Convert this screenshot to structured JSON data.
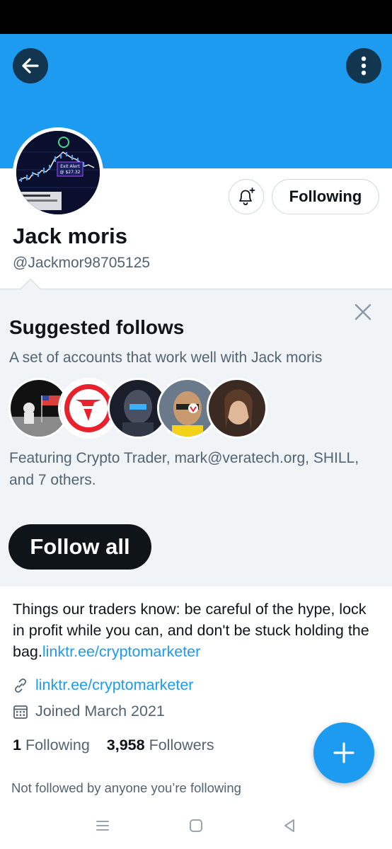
{
  "colors": {
    "accent": "#1d9bf0",
    "text": "#0f1419",
    "secondary": "#536471",
    "banner": "#1d9bf0",
    "panel_bg": "#f1f4f7"
  },
  "header": {
    "back_icon": "arrow-left-icon",
    "more_icon": "more-vertical-icon"
  },
  "profile": {
    "display_name": "Jack moris",
    "handle": "@Jackmor98705125",
    "following_button": "Following",
    "notify_icon": "bell-plus-icon",
    "avatar_text_top": "Exit Alert",
    "avatar_text_price": "@ $27.32"
  },
  "suggested": {
    "title": "Suggested follows",
    "subtitle": "A set of accounts that work well with Jack moris",
    "featuring": "Featuring Crypto Trader, mark@veratech.org, SHILL, and 7 others.",
    "follow_all": "Follow all",
    "close_icon": "close-icon"
  },
  "bio": {
    "text": "Things our traders know: be careful of the hype, lock in profit while you can, and don't be stuck holding the bag.",
    "link": "linktr.ee/cryptomarketer"
  },
  "meta": {
    "website": "linktr.ee/cryptomarketer",
    "joined": "Joined March 2021"
  },
  "stats": {
    "following_count": "1",
    "following_label": "Following",
    "followers_count": "3,958",
    "followers_label": "Followers"
  },
  "not_followed": "Not followed by anyone you’re following",
  "nav": {
    "menu_icon": "recent-apps-icon",
    "home_icon": "home-square-icon",
    "back_icon": "triangle-back-icon"
  }
}
